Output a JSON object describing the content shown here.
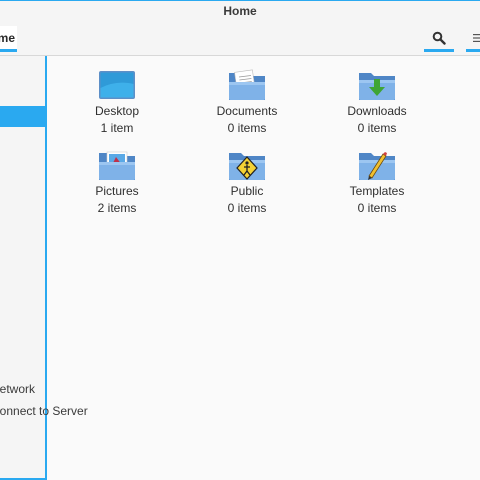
{
  "window": {
    "title": "Home"
  },
  "toolbar": {
    "breadcrumb_label": "Home"
  },
  "sidebar": {
    "items": [
      {
        "label": "Network"
      },
      {
        "label": "Connect to Server"
      }
    ]
  },
  "files": [
    {
      "name": "Desktop",
      "count": "1 item",
      "icon": "desktop-folder-icon"
    },
    {
      "name": "Documents",
      "count": "0 items",
      "icon": "documents-folder-icon"
    },
    {
      "name": "Downloads",
      "count": "0 items",
      "icon": "downloads-folder-icon"
    },
    {
      "name": "Pictures",
      "count": "2 items",
      "icon": "pictures-folder-icon"
    },
    {
      "name": "Public",
      "count": "0 items",
      "icon": "public-folder-icon"
    },
    {
      "name": "Templates",
      "count": "0 items",
      "icon": "templates-folder-icon"
    }
  ],
  "colors": {
    "accent": "#2aa9f0",
    "folder": "#6fa3de"
  }
}
